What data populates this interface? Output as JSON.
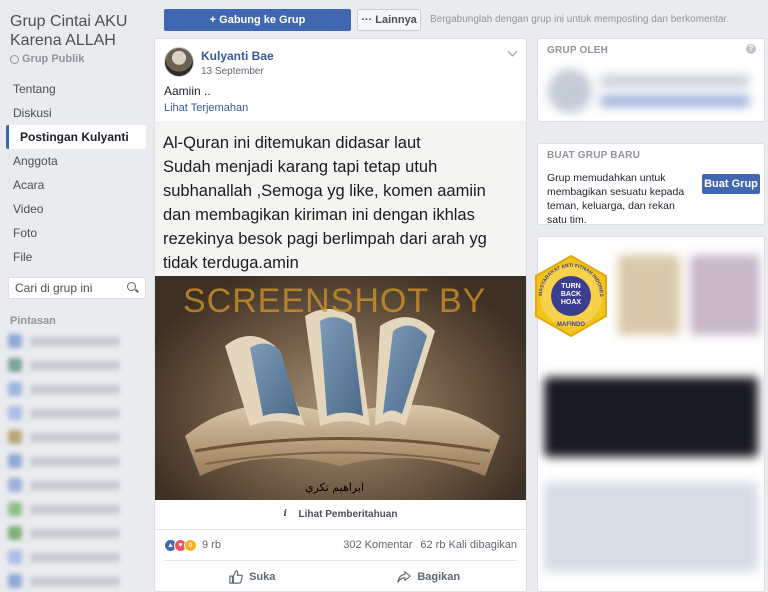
{
  "group": {
    "title": "Grup Cintai AKU Karena ALLAH",
    "type": "Grup Publik"
  },
  "nav": {
    "items": [
      "Tentang",
      "Diskusi",
      "Postingan Kulyanti",
      "Anggota",
      "Acara",
      "Video",
      "Foto",
      "File"
    ],
    "active_index": 2
  },
  "search": {
    "placeholder": "Cari di grup ini"
  },
  "shortcuts": {
    "label": "Pintasan"
  },
  "topbar": {
    "join_label": "+ Gabung ke Grup",
    "more_label": "··· Lainnya",
    "hint": "Bergabunglah dengan grup ini untuk memposting dan berkomentar."
  },
  "post": {
    "author": "Kulyanti Bae",
    "date": "13 September",
    "text": "Aamiin ..",
    "translate_label": "Lihat Terjemahan",
    "image_text": [
      "Al-Quran ini ditemukan didasar laut",
      "Sudah menjadi karang tapi tetap utuh",
      "subhanallah ,Semoga yg like, komen aamiin",
      "dan membagikan kiriman ini dengan ikhlas",
      "rezekinya besok pagi berlimpah dari arah yg",
      "tidak terduga.amin"
    ],
    "watermark": "SCREENSHOT BY",
    "signature": "ابراهيم تكري",
    "notice_label": "Lihat Pemberitahuan",
    "reaction_count": "9 rb",
    "comments": "302 Komentar",
    "shares": "62 rb Kali dibagikan",
    "like_label": "Suka",
    "share_label": "Bagikan"
  },
  "right": {
    "group_by_label": "GRUP OLEH",
    "create_group": {
      "heading": "BUAT GRUP BARU",
      "text": "Grup memudahkan untuk membagikan sesuatu kepada teman, keluarga, dan rekan satu tim.",
      "button": "Buat Grup"
    }
  },
  "hoax_badge": {
    "ring_text": "MASYARAKAT ANTI FITNAH INDONESIA",
    "center_text": "TURN BACK HOAX",
    "bottom_text": "MAFINDO"
  },
  "colors": {
    "brand": "#4267b2",
    "link": "#385898",
    "background": "#e9ebee"
  }
}
